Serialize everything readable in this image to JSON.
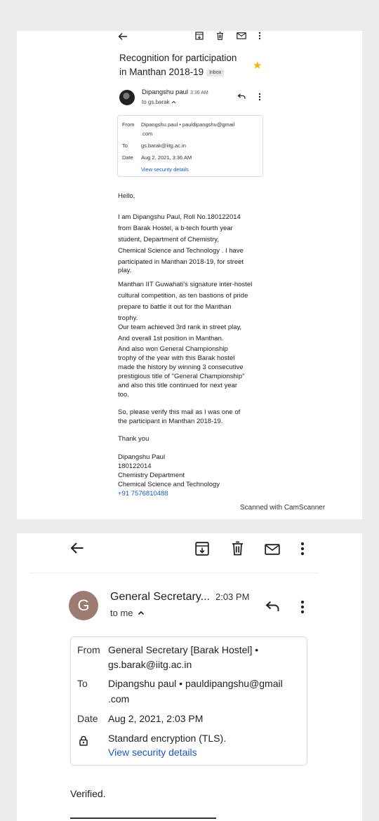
{
  "top_email": {
    "subject_line1": "Recognition for participation",
    "subject_line2": "in Manthan 2018-19",
    "label_badge": "Inbox",
    "sender_name": "Dipangshu paul",
    "sent_time": "3:36 AM",
    "to_line": "to gs.barak",
    "details": {
      "from_label": "From",
      "from_value_line1": "Dipangshu paul • pauldipangshu@gmail",
      "from_value_line2": ".com",
      "to_label": "To",
      "to_value": "gs.barak@iitg.ac.in",
      "date_label": "Date",
      "date_value": "Aug 2, 2021, 3:36 AM",
      "security_link": "View security details"
    },
    "body": {
      "greeting": "Hello,",
      "para1": [
        "I am Dipangshu Paul, Roll No.180122014",
        "from Barak Hostel, a b-tech fourth year",
        "student, Department of Chemistry,",
        "Chemical Science and Technology . I have",
        "participated in Manthan 2018-19, for street",
        "play."
      ],
      "para2": [
        "Manthan IIT Guwahati's signature inter-hostel",
        "cultural competition, as ten bastions of pride",
        "prepare to battle it out for the Manthan",
        "trophy."
      ],
      "para3": [
        "Our team achieved 3rd rank in street play,",
        "And overall 1st position in Manthan."
      ],
      "para4": [
        "And also won General Championship",
        "trophy of the year with this Barak hostel",
        "made the history by winning 3 consecutive",
        "prestigious title of \"General Championship\"",
        "and also this title continued for next year",
        "too."
      ],
      "para5": [
        "So, please verify this mail as I was one of",
        "the participant in Manthan 2018-19."
      ],
      "thanks": "Thank you",
      "signature": [
        "Dipangshu Paul",
        "180122014",
        "Chemistry Department",
        "Chemical Science and Technology"
      ],
      "phone": "+91 7576810488"
    },
    "scanner_caption": "Scanned with CamScanner"
  },
  "bottom_email": {
    "sender_initial": "G",
    "sender_name": "General Secretary...",
    "sent_time": "2:03 PM",
    "to_line": "to me",
    "details": {
      "from_label": "From",
      "from_value_line1": "General Secretary [Barak Hostel] •",
      "from_value_line2": "gs.barak@iitg.ac.in",
      "to_label": "To",
      "to_value_line1": "Dipangshu paul • pauldipangshu@gmail",
      "to_value_line2": ".com",
      "date_label": "Date",
      "date_value": "Aug 2, 2021, 2:03 PM",
      "encryption": "Standard encryption (TLS).",
      "security_link": "View security details"
    },
    "body_text": "Verified."
  },
  "colors": {
    "link": "#1a56c4",
    "star": "#f4b400",
    "avatar_g": "#9c7b72",
    "background": "#ececec"
  },
  "icons": [
    "back-arrow-icon",
    "archive-icon",
    "delete-icon",
    "mail-icon",
    "more-vert-icon",
    "reply-icon",
    "star-icon",
    "chevron-up-icon",
    "lock-icon"
  ]
}
